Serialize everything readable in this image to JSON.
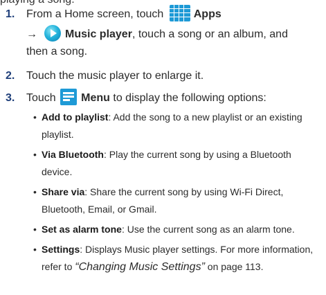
{
  "top_fragment": "playing a song:",
  "steps": [
    {
      "num": "1.",
      "pre": "From a Home screen, touch",
      "apps_label": "Apps",
      "arrow": "→",
      "music_label": "Music player",
      "post1": ", touch a song or an album, and",
      "post2": "then a song."
    },
    {
      "num": "2.",
      "text": "Touch the music player to enlarge it."
    },
    {
      "num": "3.",
      "pre": "Touch",
      "menu_label": "Menu",
      "post": "to display the following options:"
    }
  ],
  "options": [
    {
      "term": "Add to playlist",
      "desc": ": Add the song to a new playlist or an existing",
      "desc2": "playlist."
    },
    {
      "term": "Via Bluetooth",
      "desc": ": Play the current song by using a Bluetooth",
      "desc2": "device."
    },
    {
      "term": "Share via",
      "desc": ": Share the current song by using Wi-Fi Direct,",
      "desc2": "Bluetooth, Email, or Gmail."
    },
    {
      "term": "Set as alarm tone",
      "desc": ": Use the current song as an alarm tone.",
      "desc2": ""
    },
    {
      "term": "Settings",
      "desc": ": Displays Music player settings. For more information,",
      "desc2_pre": "refer to ",
      "desc2_ref": "“Changing Music Settings”",
      "desc2_post": "  on page 113."
    }
  ]
}
